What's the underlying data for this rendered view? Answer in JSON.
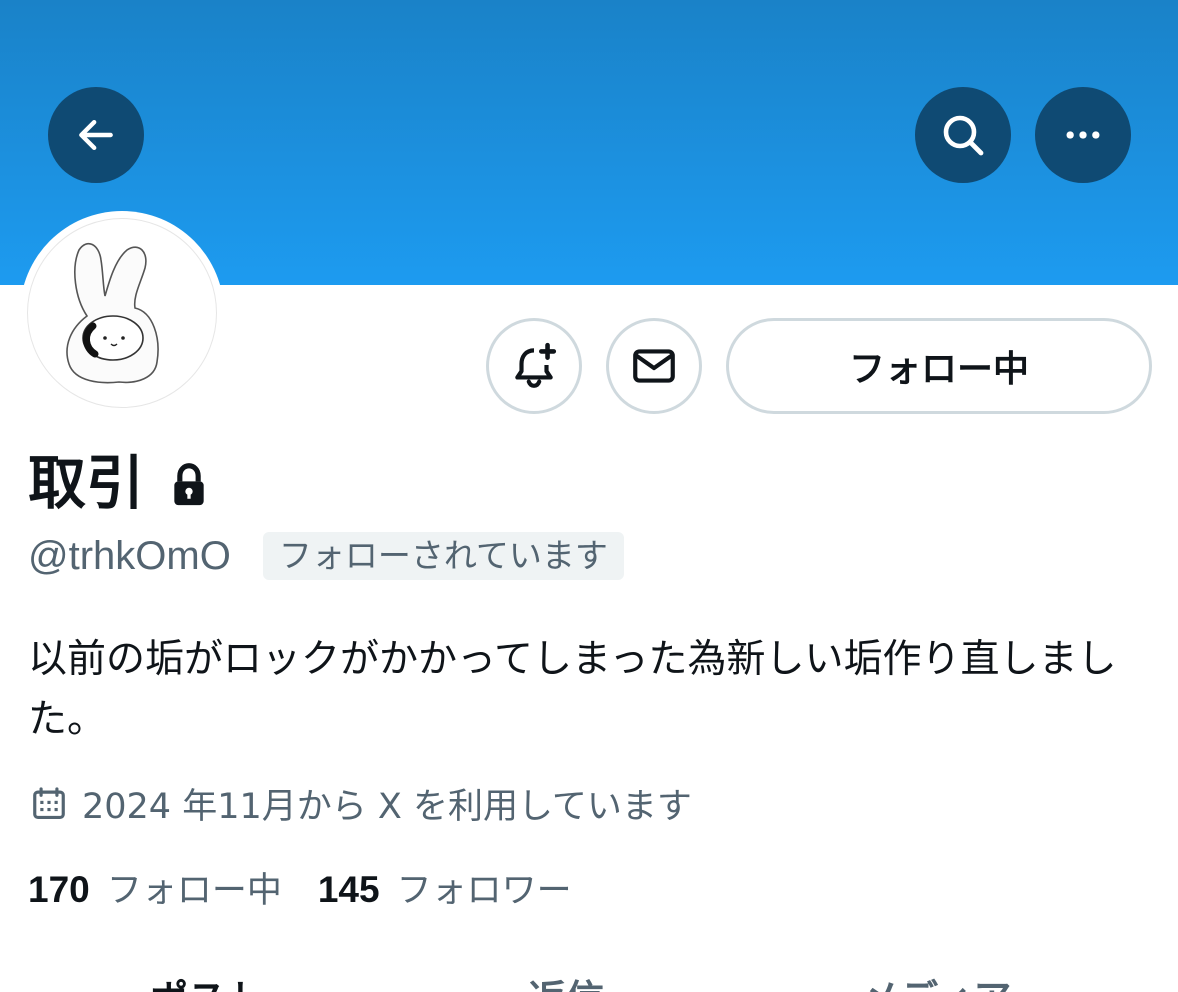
{
  "profile": {
    "display_name": "取引",
    "handle": "@trhkOmO",
    "follows_you_badge": "フォローされています",
    "bio": "以前の垢がロックがかかってしまった為新しい垢作り直しました。",
    "joined": "2024 年11月から X を利用しています",
    "protected_icon": "lock-icon"
  },
  "actions": {
    "follow_label": "フォロー中",
    "notify_icon": "bell-plus-icon",
    "dm_icon": "envelope-icon"
  },
  "header": {
    "back_icon": "arrow-left-icon",
    "search_icon": "search-icon",
    "more_icon": "more-horizontal-icon",
    "banner_color": "#1d9bf0",
    "button_color": "#0f4a73"
  },
  "stats": {
    "following_count": "170",
    "following_label": "フォロー中",
    "followers_count": "145",
    "followers_label": "フォロワー"
  },
  "tabs": [
    {
      "label": "ポスト"
    },
    {
      "label": "返信"
    },
    {
      "label": "メディア"
    }
  ]
}
